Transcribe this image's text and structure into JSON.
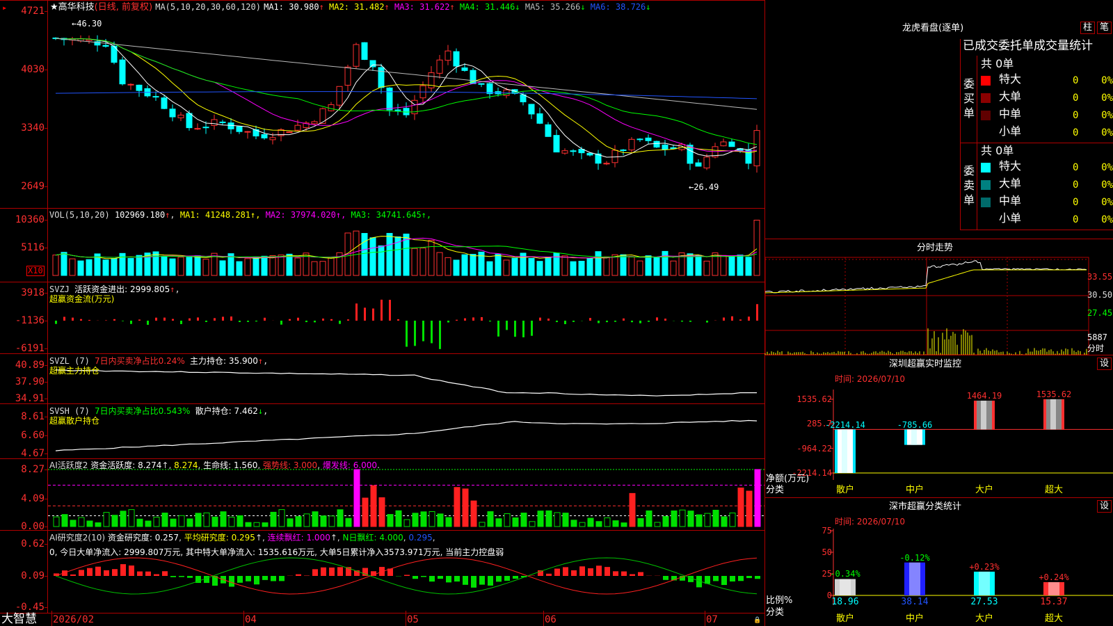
{
  "app": {
    "logo": "大智慧",
    "star": "★"
  },
  "stock": {
    "name": "高华科技",
    "mode": "(日线, 前复权)"
  },
  "price_panel": {
    "ma_prefix": "MA(5,10,20,30,60,120)",
    "ma": [
      {
        "label": "MA1: 30.980",
        "arrow": "↑",
        "color": "#ffffff"
      },
      {
        "label": "MA2: 31.482",
        "arrow": "↑",
        "color": "#ffff00"
      },
      {
        "label": "MA3: 31.622",
        "arrow": "↑",
        "color": "#ff00ff"
      },
      {
        "label": "MA4: 31.446",
        "arrow": "↓",
        "color": "#00ff00"
      },
      {
        "label": "MA5: 35.266",
        "arrow": "↓",
        "color": "#bbbbbb"
      },
      {
        "label": "MA6: 38.726",
        "arrow": "↓",
        "color": "#2255ff"
      }
    ],
    "yticks": [
      "4721",
      "4030",
      "3340",
      "2649"
    ],
    "high_mark": "46.30",
    "low_mark": "26.49"
  },
  "vol_panel": {
    "title": "VOL(5,10,20)",
    "value": "102969.180",
    "arrow": "↑",
    "ma": [
      {
        "label": "MA1: 41248.281",
        "arrow": "↑",
        "color": "#ffff00"
      },
      {
        "label": "MA2: 37974.020",
        "arrow": "↑",
        "color": "#ff00ff"
      },
      {
        "label": "MA3: 34741.645",
        "arrow": "↑",
        "color": "#00ff00"
      }
    ],
    "yticks": [
      "10360",
      "5116"
    ],
    "unit": "X10"
  },
  "svzj_panel": {
    "title": "SVZJ",
    "desc": "活跃资金进出: 2999.805",
    "arrow": "↑",
    "sub": "超赢资金流(万元)",
    "yticks": [
      "3918",
      "-1136",
      "-6191"
    ]
  },
  "svzl_panel": {
    "title": "SVZL (7)",
    "desc1": "7日内买卖净占比0.24%",
    "desc2": "主力持仓: 35.900",
    "arrow": "↑",
    "sub": "超赢主力持仓",
    "yticks": [
      "40.89",
      "37.90",
      "34.91"
    ]
  },
  "svsh_panel": {
    "title": "SVSH (7)",
    "desc1": "7日内买卖净占比0.543%",
    "desc2": "散户持仓: 7.462",
    "arrow": "↓",
    "sub": "超赢散户持仓",
    "yticks": [
      "8.61",
      "6.60",
      "4.67"
    ]
  },
  "ai_active_panel": {
    "title": "AI活跃度2",
    "v1": "资金活跃度: 8.274",
    "v2": "8.274",
    "v3": "生命线: 1.560",
    "v4": "强势线: 3.000",
    "v5": "爆发线: 6.000",
    "yticks": [
      "8.27",
      "4.09",
      "0.00"
    ]
  },
  "ai_research_panel": {
    "title": "AI研究度2(10)",
    "v1": "资金研究度: 0.257",
    "v2": "平均研究度: 0.295",
    "v3": "连续飘红: 1.000",
    "v4": "N日飘红: 4.000",
    "v5": "0.295",
    "summary": "0, 今日大单净流入: 2999.807万元, 其中特大单净流入: 1535.616万元, 大单5日累计净入3573.971万元, 当前主力控盘弱",
    "yticks": [
      "0.62",
      "0.09",
      "-0.45"
    ]
  },
  "xaxis": {
    "labels": [
      "2026/02",
      "04",
      "05",
      "06",
      "07"
    ]
  },
  "longhu": {
    "title": "龙虎看盘(逐单)",
    "btn1": "柱",
    "btn2": "笔",
    "stats_title": "已成交委托单成交量统计",
    "buy": {
      "side": "委买单",
      "total": "共 0单",
      "rows": [
        {
          "name": "特大",
          "count": "0",
          "pct": "0%",
          "color": "#ff0000"
        },
        {
          "name": "大单",
          "count": "0",
          "pct": "0%",
          "color": "#8b0000"
        },
        {
          "name": "中单",
          "count": "0",
          "pct": "0%",
          "color": "#600000"
        },
        {
          "name": "小单",
          "count": "0",
          "pct": "0%",
          "color": "#000000"
        }
      ]
    },
    "sell": {
      "side": "委卖单",
      "total": "共 0单",
      "rows": [
        {
          "name": "特大",
          "count": "0",
          "pct": "0%",
          "color": "#00ffff"
        },
        {
          "name": "大单",
          "count": "0",
          "pct": "0%",
          "color": "#008080"
        },
        {
          "name": "中单",
          "count": "0",
          "pct": "0%",
          "color": "#006a6a"
        },
        {
          "name": "小单",
          "count": "0",
          "pct": "0%",
          "color": "#000000"
        }
      ]
    }
  },
  "intraday": {
    "title": "分时走势",
    "prices": [
      "33.55",
      "30.50",
      "27.45"
    ],
    "vol_tick": "5887",
    "vol_label": "分时"
  },
  "monitor": {
    "title": "深圳超赢实时监控",
    "btn": "设",
    "time": "时间: 2026/07/10",
    "yticks": [
      "1535.62",
      "285.7",
      "-964.22",
      "-2214.14"
    ],
    "ylabel": "净额(万元)",
    "xlabel": "分类",
    "bars": [
      {
        "cat": "散户",
        "value": -2214.14,
        "label": "-2214.14"
      },
      {
        "cat": "中户",
        "value": -785.66,
        "label": "-785.66"
      },
      {
        "cat": "大户",
        "value": 1464.19,
        "label": "1464.19"
      },
      {
        "cat": "超大",
        "value": 1535.62,
        "label": "1535.62"
      }
    ]
  },
  "classify": {
    "title": "深市超赢分类统计",
    "btn": "设",
    "time": "时间: 2026/07/10",
    "yticks": [
      "75",
      "50",
      "25",
      "0"
    ],
    "ylabel": "比例%",
    "xlabel": "分类",
    "bars": [
      {
        "cat": "散户",
        "value": 18.96,
        "change": "-0.34%",
        "color": "#d0d0d0"
      },
      {
        "cat": "中户",
        "value": 38.14,
        "change": "-0.12%",
        "color": "#2020ff"
      },
      {
        "cat": "大户",
        "value": 27.53,
        "change": "+0.23%",
        "color": "#00ffff"
      },
      {
        "cat": "超大",
        "value": 15.37,
        "change": "+0.24%",
        "color": "#ff3030"
      }
    ]
  },
  "chart_data": [
    {
      "type": "bar",
      "title": "深圳超赢实时监控",
      "categories": [
        "散户",
        "中户",
        "大户",
        "超大"
      ],
      "values": [
        -2214.14,
        -785.66,
        1464.19,
        1535.62
      ],
      "xlabel": "分类",
      "ylabel": "净额(万元)",
      "ylim": [
        -2214.14,
        1535.62
      ]
    },
    {
      "type": "bar",
      "title": "深市超赢分类统计",
      "categories": [
        "散户",
        "中户",
        "大户",
        "超大"
      ],
      "values": [
        18.96,
        38.14,
        27.53,
        15.37
      ],
      "xlabel": "分类",
      "ylabel": "比例%",
      "ylim": [
        0,
        75
      ]
    }
  ]
}
